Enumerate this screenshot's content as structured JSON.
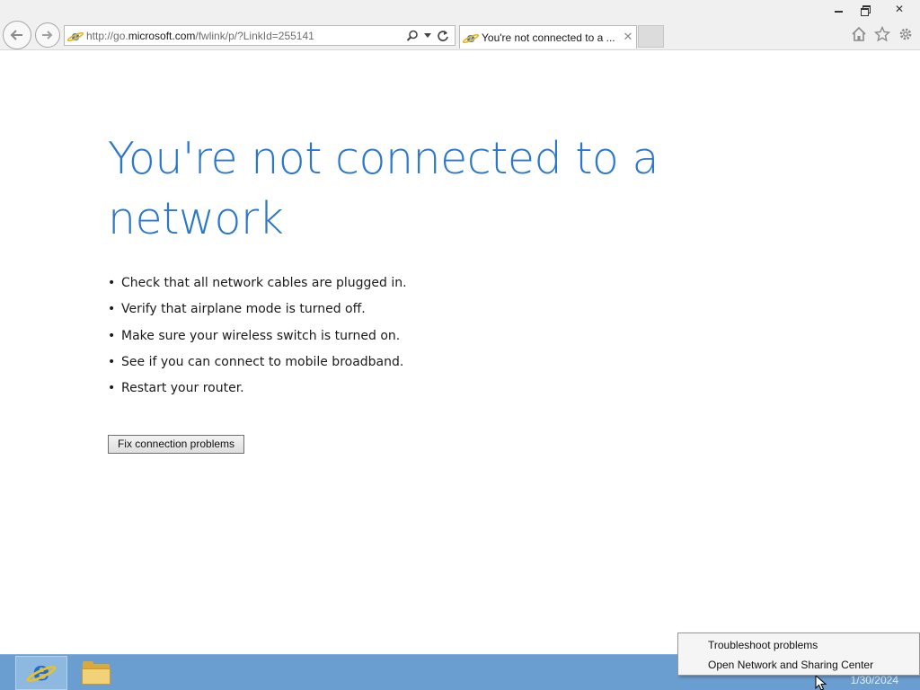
{
  "browser": {
    "url_prefix": "http://go.",
    "url_domain": "microsoft.com",
    "url_path": "/fwlink/p/?LinkId=255141",
    "tab_title": "You're not connected to a ...",
    "close_glyph": "✕"
  },
  "page": {
    "headline": "You're not connected to a network",
    "bullets": [
      "Check that all network cables are plugged in.",
      "Verify that airplane mode is turned off.",
      "Make sure your wireless switch is turned on.",
      "See if you can connect to mobile broadband.",
      "Restart your router."
    ],
    "fix_button_label": "Fix connection problems"
  },
  "context_menu": {
    "items": [
      "Troubleshoot problems",
      "Open Network and Sharing Center"
    ]
  },
  "taskbar": {
    "date": "1/30/2024",
    "apps": [
      "internet-explorer-icon",
      "file-explorer-icon"
    ]
  },
  "colors": {
    "headline": "#2b77cd",
    "taskbar": "#6a9ed0",
    "chrome": "#f0f0f0"
  }
}
